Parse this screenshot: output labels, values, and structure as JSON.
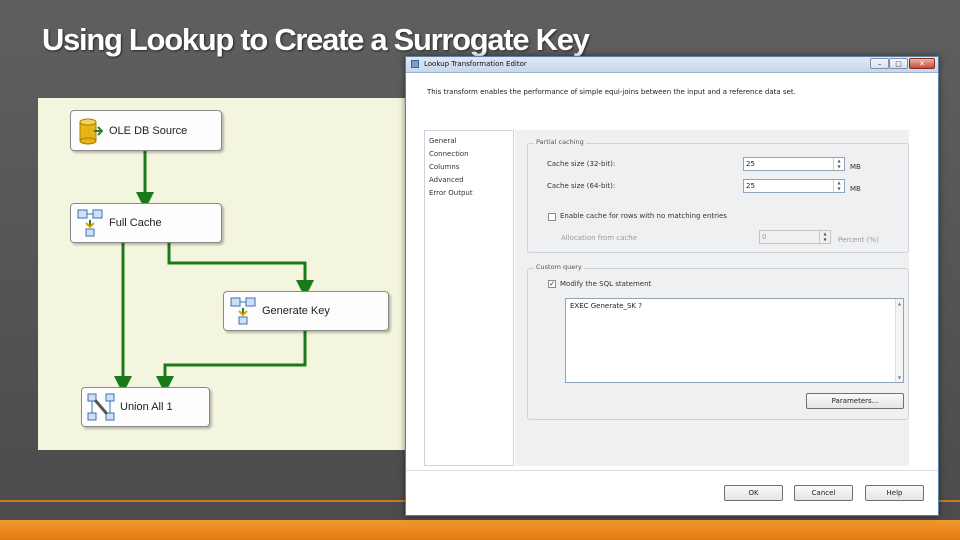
{
  "slide": {
    "title": "Using Lookup to Create a Surrogate Key"
  },
  "diagram": {
    "nodes": {
      "ole_db_source": "OLE DB Source",
      "full_cache": "Full Cache",
      "generate_key": "Generate Key",
      "union_all": "Union All 1"
    },
    "arrow_color": "#1a7a1a"
  },
  "dialog": {
    "title": "Lookup Transformation Editor",
    "description": "This transform enables the performance of simple equi-joins between the input and a reference data set.",
    "nav": [
      "General",
      "Connection",
      "Columns",
      "Advanced",
      "Error Output"
    ],
    "partial_caching": {
      "legend": "Partial caching",
      "cache32_label": "Cache size (32-bit):",
      "cache32_value": "25",
      "cache32_unit": "MB",
      "cache64_label": "Cache size (64-bit):",
      "cache64_value": "25",
      "cache64_unit": "MB",
      "enable_cache_label": "Enable cache for rows with no matching entries",
      "enable_cache_checked": false,
      "allocation_label": "Allocation from cache",
      "allocation_value": "0",
      "allocation_unit": "Percent (%)"
    },
    "custom_query": {
      "legend": "Custom query",
      "modify_sql_label": "Modify the SQL statement",
      "modify_sql_checked": true,
      "sql_text": "EXEC Generate_SK ?"
    },
    "buttons": {
      "parameters": "Parameters...",
      "ok": "OK",
      "cancel": "Cancel",
      "help": "Help"
    }
  }
}
